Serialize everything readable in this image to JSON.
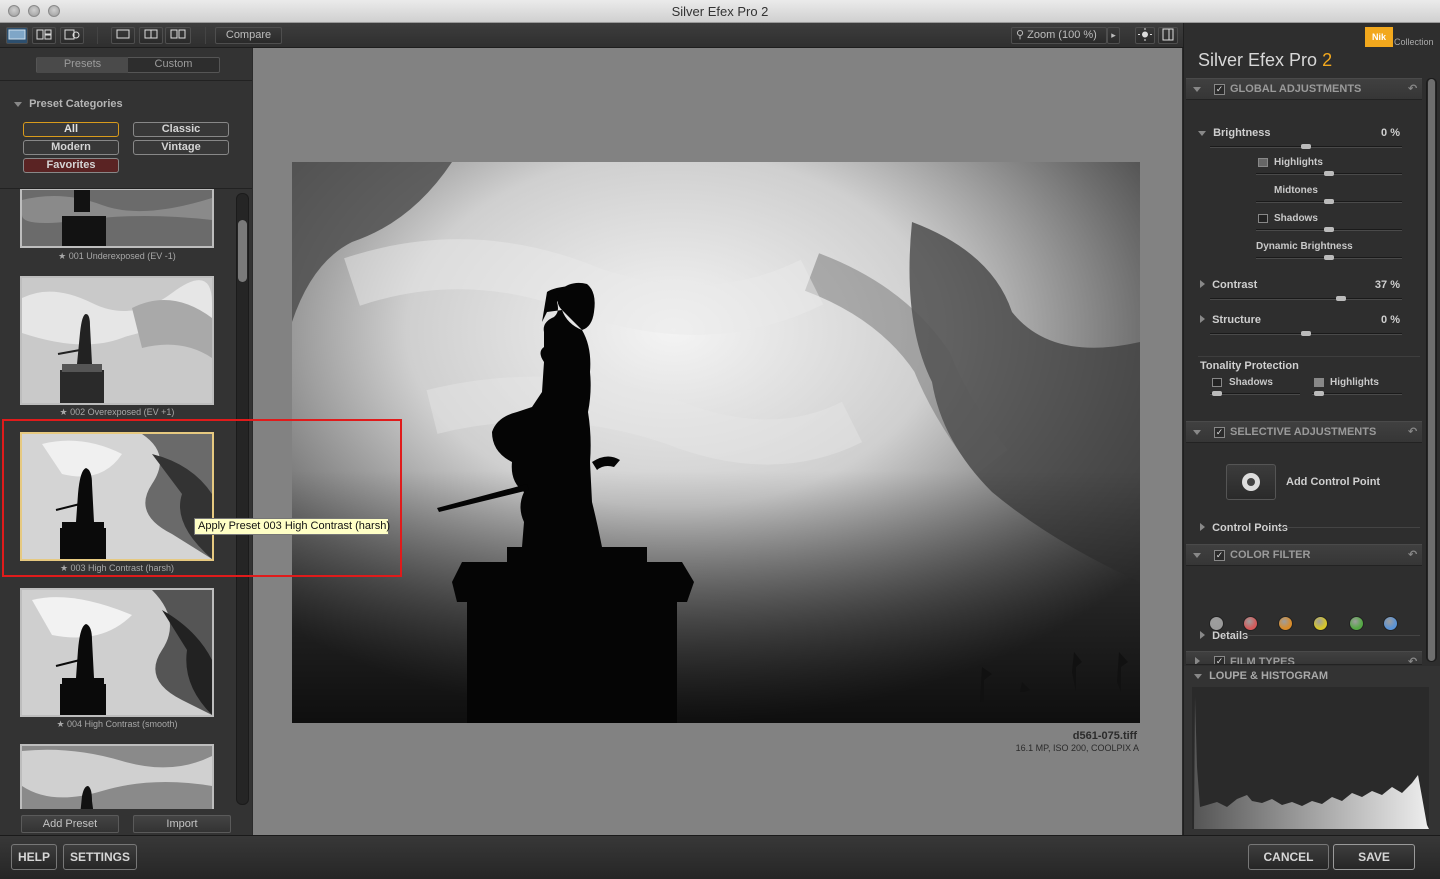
{
  "window": {
    "title": "Silver Efex Pro 2"
  },
  "toolbar": {
    "compare_label": "Compare",
    "zoom_label": "Zoom (100 %)"
  },
  "left_panel": {
    "tabs": [
      "Presets",
      "Custom"
    ],
    "categories_title": "Preset Categories",
    "categories": [
      "All",
      "Classic",
      "Modern",
      "Vintage",
      "Favorites"
    ],
    "presets": [
      {
        "label": "★ 001 Underexposed (EV -1)"
      },
      {
        "label": "★ 002 Overexposed (EV +1)"
      },
      {
        "label": "★ 003 High Contrast (harsh)"
      },
      {
        "label": "★ 004 High Contrast (smooth)"
      }
    ],
    "add_preset_label": "Add Preset",
    "import_label": "Import"
  },
  "tooltip": "Apply Preset 003 High Contrast (harsh)",
  "image_info": {
    "filename": "d561-075.tiff",
    "details": "16.1 MP, ISO 200, COOLPIX A"
  },
  "right_panel": {
    "brand": "Nik",
    "brand_sub": "Collection",
    "product_name": "Silver Efex Pro",
    "product_version": "2",
    "global": {
      "header": "GLOBAL ADJUSTMENTS",
      "brightness": {
        "label": "Brightness",
        "value": "0 %",
        "level": 0.5
      },
      "highlights": {
        "label": "Highlights",
        "level": 0.5
      },
      "midtones": {
        "label": "Midtones",
        "level": 0.5
      },
      "shadows": {
        "label": "Shadows",
        "level": 0.5
      },
      "dynamic": {
        "label": "Dynamic Brightness",
        "level": 0.5
      },
      "contrast": {
        "label": "Contrast",
        "value": "37 %",
        "level": 0.68
      },
      "structure": {
        "label": "Structure",
        "value": "0 %",
        "level": 0.5
      },
      "tonality": {
        "label": "Tonality Protection",
        "shadows": "Shadows",
        "highlights": "Highlights"
      }
    },
    "selective": {
      "header": "SELECTIVE ADJUSTMENTS",
      "add_cp": "Add Control Point",
      "control_points": "Control Points"
    },
    "color_filter": {
      "header": "COLOR FILTER",
      "details": "Details",
      "swatches": [
        "#9a9a9a",
        "#d45a5a",
        "#d98c2a",
        "#d6c62a",
        "#55a845",
        "#5a93d6"
      ]
    },
    "film_types": {
      "header": "FILM TYPES"
    },
    "loupe": {
      "header": "LOUPE & HISTOGRAM"
    }
  },
  "bottom": {
    "help": "HELP",
    "settings": "SETTINGS",
    "cancel": "CANCEL",
    "save": "SAVE"
  }
}
